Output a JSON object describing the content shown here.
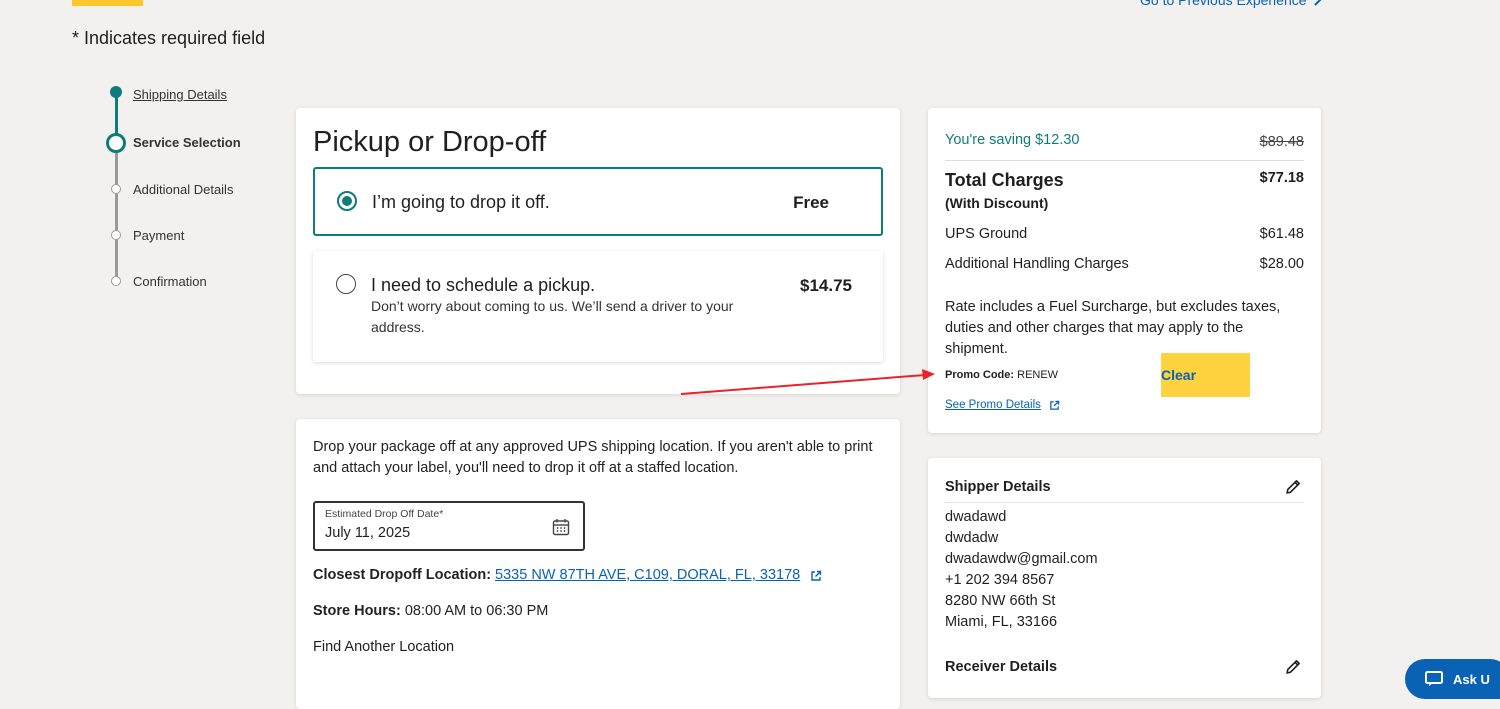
{
  "header": {
    "previous_experience_label": "Go to Previous Experience",
    "required_note": "* Indicates required field"
  },
  "stepper": {
    "steps": [
      {
        "label": "Shipping Details",
        "state": "completed"
      },
      {
        "label": "Service Selection",
        "state": "current"
      },
      {
        "label": "Additional Details",
        "state": "upcoming"
      },
      {
        "label": "Payment",
        "state": "upcoming"
      },
      {
        "label": "Confirmation",
        "state": "upcoming"
      }
    ]
  },
  "pickup": {
    "title": "Pickup or Drop-off",
    "options": [
      {
        "title": "I’m going to drop it off.",
        "price": "Free",
        "selected": true
      },
      {
        "title": "I need to schedule a pickup.",
        "price": "$14.75",
        "description": "Don’t worry about coming to us. We’ll send a driver to your address.",
        "selected": false
      }
    ]
  },
  "dropoff": {
    "intro": "Drop your package off at any approved UPS shipping location. If you aren't able to print and attach your label, you'll need to drop it off at a staffed location.",
    "date_label": "Estimated Drop Off Date*",
    "date_value": "July 11, 2025",
    "location_label": "Closest Dropoff Location:",
    "location_value": "5335 NW 87TH AVE, C109, DORAL, FL, 33178",
    "hours_label": "Store Hours:",
    "hours_value": "08:00 AM to 06:30 PM",
    "find_another": "Find Another Location"
  },
  "summary": {
    "saving_text": "You're saving $12.30",
    "original_price": "$89.48",
    "total_label": "Total Charges",
    "total_sublabel": "(With Discount)",
    "total_value": "$77.18",
    "lines": [
      {
        "label": "UPS Ground",
        "value": "$61.48"
      },
      {
        "label": "Additional Handling Charges",
        "value": "$28.00"
      }
    ],
    "rate_note": "Rate includes a Fuel Surcharge, but excludes taxes, duties and other charges that may apply to the shipment.",
    "promo_label": "Promo Code:",
    "promo_value": "RENEW",
    "clear_label": "Clear",
    "see_promo": "See Promo Details"
  },
  "shipper": {
    "title": "Shipper Details",
    "lines": [
      "dwadawd",
      "dwdadw",
      "dwadawdw@gmail.com",
      "+1 202 394 8567",
      "8280 NW 66th St",
      "Miami, FL, 33166"
    ]
  },
  "receiver": {
    "title": "Receiver Details"
  },
  "chat": {
    "label": "Ask U"
  },
  "colors": {
    "teal": "#0e7c7b",
    "link": "#0a62b5",
    "yellow": "#ffc72c",
    "annotation_red": "#e8232a"
  },
  "icons": [
    "chevron-right-icon",
    "calendar-icon",
    "external-link-icon",
    "pencil-icon",
    "chat-icon"
  ]
}
